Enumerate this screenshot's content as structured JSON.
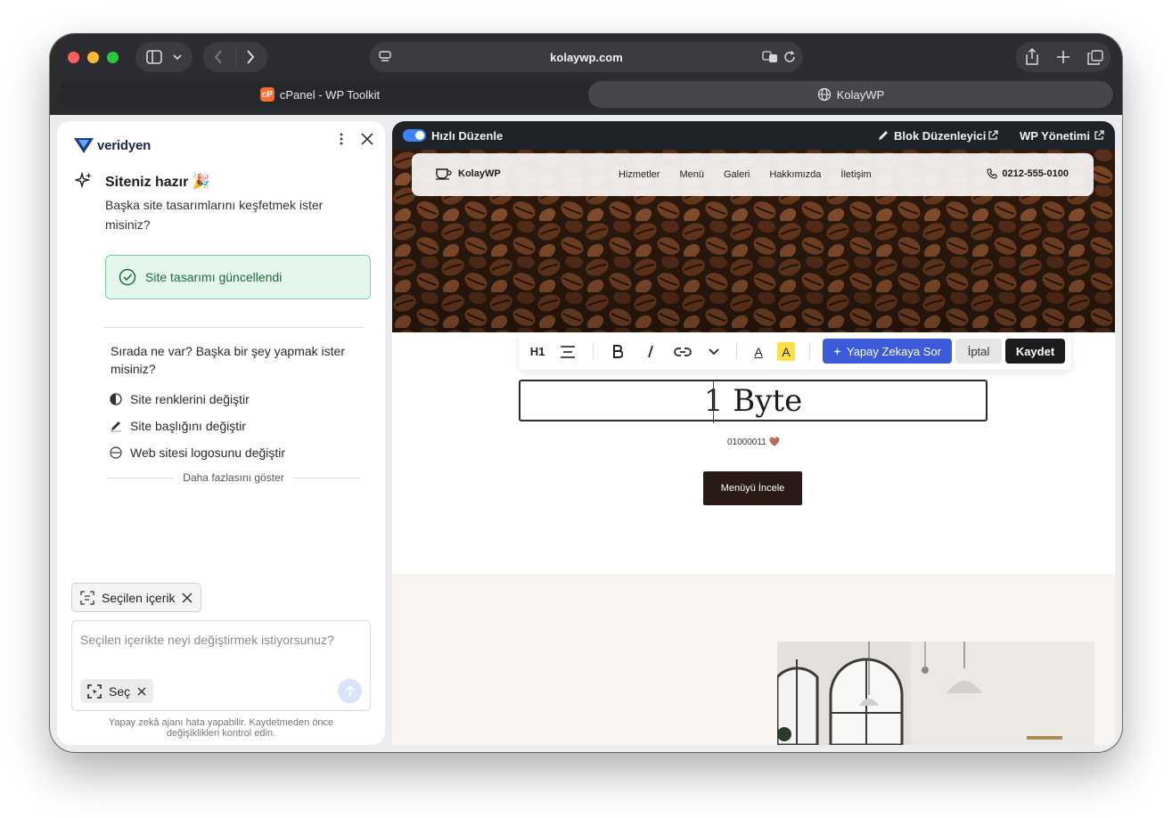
{
  "browser": {
    "url": "kolaywp.com",
    "tabs": [
      {
        "label": "cPanel - WP Toolkit",
        "active": false
      },
      {
        "label": "KolayWP",
        "active": true
      }
    ]
  },
  "sidebar": {
    "brand": "veridyen",
    "title": "Siteniz hazır 🎉",
    "subtitle": "Başka site tasarımlarını keşfetmek ister misiniz?",
    "success_message": "Site tasarımı güncellendi",
    "next_question": "Sırada ne var? Başka bir şey yapmak ister misiniz?",
    "suggestions": [
      {
        "label": "Site renklerini değiştir",
        "icon": "contrast-icon"
      },
      {
        "label": "Site başlığını değiştir",
        "icon": "pencil-icon"
      },
      {
        "label": "Web sitesi logosunu değiştir",
        "icon": "logo-circle-icon"
      }
    ],
    "show_more": "Daha fazlasını göster",
    "selected_chip": "Seçilen içerik",
    "composer_placeholder": "Seçilen içerikte neyi değiştirmek istiyorsunuz?",
    "pick_label": "Seç",
    "disclaimer": "Yapay zekâ ajanı hata yapabilir. Kaydetmeden önce değişiklikleri kontrol edin."
  },
  "editor": {
    "quick_edit": "Hızlı Düzenle",
    "block_editor": "Blok Düzenleyici",
    "wp_admin": "WP Yönetimi",
    "toolbar": {
      "heading": "H1",
      "ai_button": "Yapay Zekaya Sor",
      "cancel": "İptal",
      "save": "Kaydet",
      "text_color": "A",
      "highlight": "A"
    }
  },
  "site": {
    "logo": "KolayWP",
    "nav": [
      "Hizmetler",
      "Menü",
      "Galeri",
      "Hakkımızda",
      "İletişim"
    ],
    "phone": "0212-555-0100",
    "heading": "1 Byte",
    "binary": "01000011 🤎",
    "cta": "Menüyü İncele"
  },
  "colors": {
    "accent": "#3b5bdb",
    "success_bg": "#e5f6ec",
    "success_border": "#7ecf9b",
    "toolbar_dark": "#1f2328",
    "cta_dark": "#2a1a18"
  }
}
